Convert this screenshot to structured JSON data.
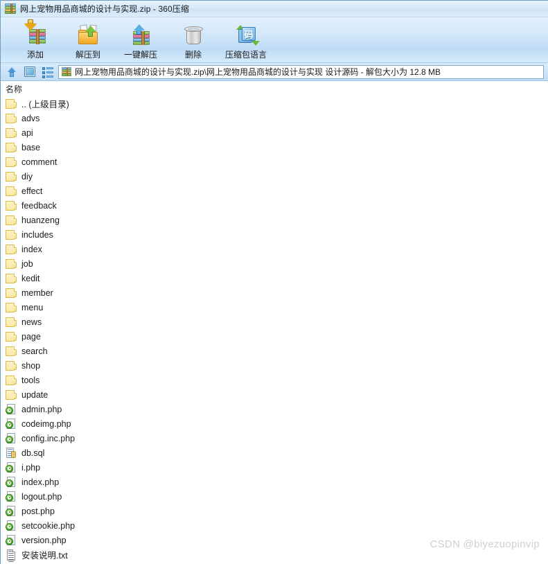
{
  "window": {
    "title": "网上宠物用品商城的设计与实现.zip  -  360压缩",
    "app_icon": "zip-archive-icon"
  },
  "toolbar": {
    "buttons": [
      {
        "label": "添加",
        "icon": "add-to-archive-icon"
      },
      {
        "label": "解压到",
        "icon": "extract-to-folder-icon"
      },
      {
        "label": "一键解压",
        "icon": "one-click-extract-icon"
      },
      {
        "label": "删除",
        "icon": "trash-delete-icon"
      },
      {
        "label": "压缩包语言",
        "icon": "archive-language-icon",
        "glyph": "码"
      }
    ]
  },
  "navbar": {
    "up_icon": "up-arrow-icon",
    "view_icon": "view-mode-icon",
    "list_icon": "list-view-icon",
    "address_icon": "zip-archive-icon",
    "address": "网上宠物用品商城的设计与实现.zip\\网上宠物用品商城的设计与实现 设计源码 - 解包大小为 12.8 MB"
  },
  "list": {
    "columns": [
      "名称"
    ],
    "rows": [
      {
        "name": ".. (上级目录)",
        "type": "folder"
      },
      {
        "name": "advs",
        "type": "folder"
      },
      {
        "name": "api",
        "type": "folder"
      },
      {
        "name": "base",
        "type": "folder"
      },
      {
        "name": "comment",
        "type": "folder"
      },
      {
        "name": "diy",
        "type": "folder"
      },
      {
        "name": "effect",
        "type": "folder"
      },
      {
        "name": "feedback",
        "type": "folder"
      },
      {
        "name": "huanzeng",
        "type": "folder"
      },
      {
        "name": "includes",
        "type": "folder"
      },
      {
        "name": "index",
        "type": "folder"
      },
      {
        "name": "job",
        "type": "folder"
      },
      {
        "name": "kedit",
        "type": "folder"
      },
      {
        "name": "member",
        "type": "folder"
      },
      {
        "name": "menu",
        "type": "folder"
      },
      {
        "name": "news",
        "type": "folder"
      },
      {
        "name": "page",
        "type": "folder"
      },
      {
        "name": "search",
        "type": "folder"
      },
      {
        "name": "shop",
        "type": "folder"
      },
      {
        "name": "tools",
        "type": "folder"
      },
      {
        "name": "update",
        "type": "folder"
      },
      {
        "name": "admin.php",
        "type": "php"
      },
      {
        "name": "codeimg.php",
        "type": "php"
      },
      {
        "name": "config.inc.php",
        "type": "php"
      },
      {
        "name": "db.sql",
        "type": "sql"
      },
      {
        "name": "i.php",
        "type": "php"
      },
      {
        "name": "index.php",
        "type": "php"
      },
      {
        "name": "logout.php",
        "type": "php"
      },
      {
        "name": "post.php",
        "type": "php"
      },
      {
        "name": "setcookie.php",
        "type": "php"
      },
      {
        "name": "version.php",
        "type": "php"
      },
      {
        "name": "安装说明.txt",
        "type": "txt"
      }
    ]
  },
  "watermark": {
    "text": "CSDN @biyezuopinvip"
  },
  "colors": {
    "title_bar": "#d5e8f8",
    "toolbar": "#cfe6f9",
    "addr_bar": "#cbe3f6",
    "list_bg": "#ffffff",
    "folder": "#fbe9a6",
    "folder_border": "#e0b93f",
    "php_green": "#4ba32a",
    "text": "#1b1b1b",
    "watermark": "#d0d0d0"
  }
}
